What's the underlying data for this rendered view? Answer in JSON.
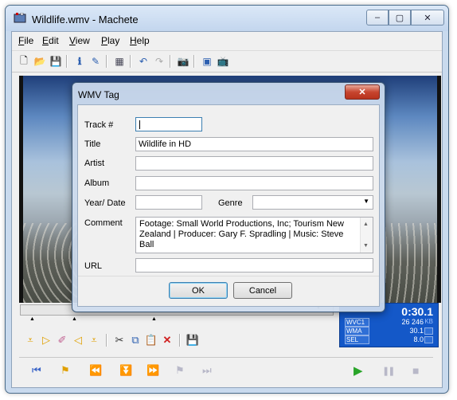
{
  "window": {
    "title": "Wildlife.wmv - Machete",
    "cap_min": "–",
    "cap_max": "▢",
    "cap_close": "✕"
  },
  "menu": [
    {
      "label": "File",
      "u": "F",
      "rest": "ile"
    },
    {
      "label": "Edit",
      "u": "E",
      "rest": "dit"
    },
    {
      "label": "View",
      "u": "V",
      "rest": "iew"
    },
    {
      "label": "Play",
      "u": "P",
      "rest": "lay"
    },
    {
      "label": "Help",
      "u": "H",
      "rest": "elp"
    }
  ],
  "toolbar_icons": [
    "new-icon",
    "open-icon",
    "save-icon",
    "info-icon",
    "edit-tags-icon",
    "properties-icon",
    "undo-icon",
    "redo-icon",
    "snapshot-icon",
    "export-frame-icon",
    "clip-icon"
  ],
  "dialog": {
    "title": "WMV Tag",
    "close": "✕",
    "fields": {
      "track_label": "Track #",
      "track_value": "",
      "title_label": "Title",
      "title_value": "Wildlife in HD",
      "artist_label": "Artist",
      "artist_value": "",
      "album_label": "Album",
      "album_value": "",
      "year_label": "Year/ Date",
      "year_value": "",
      "genre_label": "Genre",
      "genre_value": "",
      "comment_label": "Comment",
      "comment_value": "Footage: Small World Productions, Inc; Tourism New Zealand | Producer: Gary F. Spradling | Music: Steve Ball",
      "url_label": "URL",
      "url_value": ""
    },
    "ok": "OK",
    "cancel": "Cancel"
  },
  "info_panel": {
    "time": "0:30.1",
    "rows": [
      {
        "label": "WVC1",
        "value": "26 246",
        "unit": "KB"
      },
      {
        "label": "WMA",
        "value": "30.1",
        "unit": ""
      },
      {
        "label": "SEL",
        "value": "8.0",
        "unit": ""
      }
    ]
  },
  "transport": {
    "first": "⏮",
    "mark_in": "⚑",
    "rewind": "⏪",
    "down": "⏬",
    "forward": "⏩",
    "mark_out": "⚑",
    "last": "⏭",
    "play": "▶",
    "pause": "❚❚",
    "stop": "■"
  },
  "colors": {
    "play": "#2aa52a",
    "accent": "#1458c8",
    "edit_icons": "#e0a000"
  }
}
